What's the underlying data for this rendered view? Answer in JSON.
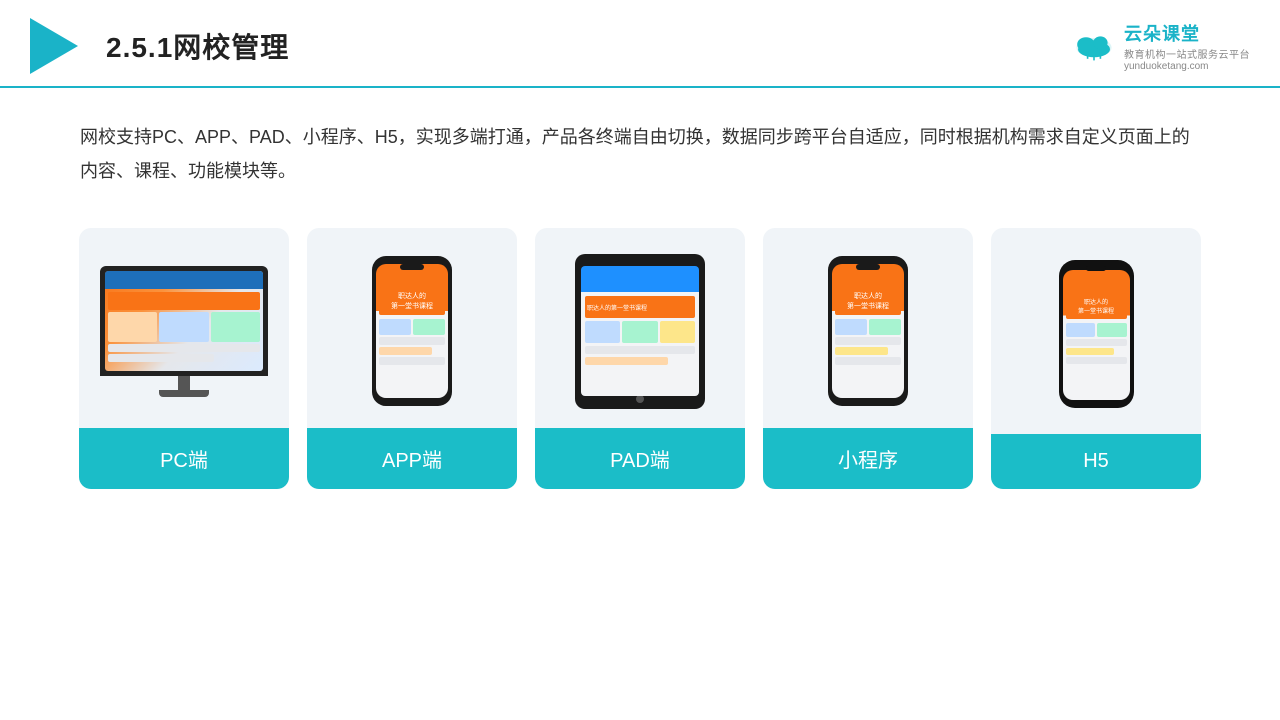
{
  "header": {
    "title": "2.5.1网校管理",
    "brand": {
      "name": "云朵课堂",
      "url": "yunduoketang.com",
      "tagline": "教育机构一站式服务云平台"
    }
  },
  "description": "网校支持PC、APP、PAD、小程序、H5，实现多端打通，产品各终端自由切换，数据同步跨平台自适应，同时根据机构需求自定义页面上的内容、课程、功能模块等。",
  "cards": [
    {
      "label": "PC端",
      "device": "pc"
    },
    {
      "label": "APP端",
      "device": "phone"
    },
    {
      "label": "PAD端",
      "device": "tablet"
    },
    {
      "label": "小程序",
      "device": "phone2"
    },
    {
      "label": "H5",
      "device": "phone3"
    }
  ],
  "accent_color": "#1bbdc8"
}
